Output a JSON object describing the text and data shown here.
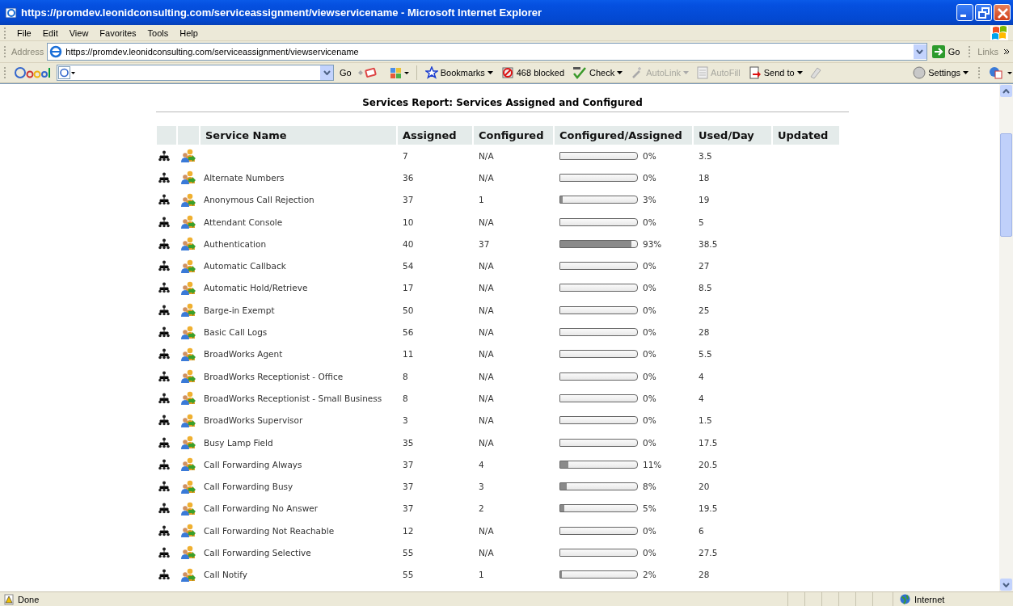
{
  "window": {
    "title": "https://promdev.leonidconsulting.com/serviceassignment/viewservicename - Microsoft Internet Explorer"
  },
  "menu": [
    "File",
    "Edit",
    "View",
    "Favorites",
    "Tools",
    "Help"
  ],
  "address_bar": {
    "label": "Address",
    "value": "https://promdev.leonidconsulting.com/serviceassignment/viewservicename",
    "go": "Go",
    "links": "Links"
  },
  "google_toolbar": {
    "go": "Go",
    "items": [
      {
        "kind": "star",
        "label": "Bookmarks",
        "disabled": false,
        "dropdown": true
      },
      {
        "kind": "blocked",
        "label": "468 blocked",
        "disabled": false,
        "dropdown": false
      },
      {
        "kind": "check",
        "label": "Check",
        "disabled": false,
        "dropdown": true
      },
      {
        "kind": "wand",
        "label": "AutoLink",
        "disabled": true,
        "dropdown": true
      },
      {
        "kind": "form",
        "label": "AutoFill",
        "disabled": true,
        "dropdown": false
      },
      {
        "kind": "send",
        "label": "Send to",
        "disabled": false,
        "dropdown": true
      }
    ],
    "settings": "Settings"
  },
  "report": {
    "title": "Services Report: Services Assigned and Configured",
    "columns": [
      "Service Name",
      "Assigned",
      "Configured",
      "Configured/Assigned",
      "Used/Day",
      "Updated"
    ],
    "rows": [
      {
        "assigned": "7",
        "configured": "N/A",
        "level": 0,
        "percent": "0%",
        "used_per_day": "3.5"
      },
      {
        "name": "Alternate Numbers",
        "assigned": "36",
        "configured": "N/A",
        "level": 0,
        "percent": "0%",
        "used_per_day": "18"
      },
      {
        "name": "Anonymous Call Rejection",
        "assigned": "37",
        "configured": "1",
        "level": 0.03,
        "percent": "3%",
        "used_per_day": "19"
      },
      {
        "name": "Attendant Console",
        "assigned": "10",
        "configured": "N/A",
        "level": 0,
        "percent": "0%",
        "used_per_day": "5"
      },
      {
        "name": "Authentication",
        "assigned": "40",
        "configured": "37",
        "level": 0.93,
        "percent": "93%",
        "used_per_day": "38.5"
      },
      {
        "name": "Automatic Callback",
        "assigned": "54",
        "configured": "N/A",
        "level": 0,
        "percent": "0%",
        "used_per_day": "27"
      },
      {
        "name": "Automatic Hold/Retrieve",
        "assigned": "17",
        "configured": "N/A",
        "level": 0,
        "percent": "0%",
        "used_per_day": "8.5"
      },
      {
        "name": "Barge-in Exempt",
        "assigned": "50",
        "configured": "N/A",
        "level": 0,
        "percent": "0%",
        "used_per_day": "25"
      },
      {
        "name": "Basic Call Logs",
        "assigned": "56",
        "configured": "N/A",
        "level": 0,
        "percent": "0%",
        "used_per_day": "28"
      },
      {
        "name": "BroadWorks Agent",
        "assigned": "11",
        "configured": "N/A",
        "level": 0,
        "percent": "0%",
        "used_per_day": "5.5"
      },
      {
        "name": "BroadWorks Receptionist - Office",
        "assigned": "8",
        "configured": "N/A",
        "level": 0,
        "percent": "0%",
        "used_per_day": "4"
      },
      {
        "name": "BroadWorks Receptionist - Small Business",
        "assigned": "8",
        "configured": "N/A",
        "level": 0,
        "percent": "0%",
        "used_per_day": "4"
      },
      {
        "name": "BroadWorks Supervisor",
        "assigned": "3",
        "configured": "N/A",
        "level": 0,
        "percent": "0%",
        "used_per_day": "1.5"
      },
      {
        "name": "Busy Lamp Field",
        "assigned": "35",
        "configured": "N/A",
        "level": 0,
        "percent": "0%",
        "used_per_day": "17.5"
      },
      {
        "name": "Call Forwarding Always",
        "assigned": "37",
        "configured": "4",
        "level": 0.11,
        "percent": "11%",
        "used_per_day": "20.5"
      },
      {
        "name": "Call Forwarding Busy",
        "assigned": "37",
        "configured": "3",
        "level": 0.08,
        "percent": "8%",
        "used_per_day": "20"
      },
      {
        "name": "Call Forwarding No Answer",
        "assigned": "37",
        "configured": "2",
        "level": 0.05,
        "percent": "5%",
        "used_per_day": "19.5"
      },
      {
        "name": "Call Forwarding Not Reachable",
        "assigned": "12",
        "configured": "N/A",
        "level": 0,
        "percent": "0%",
        "used_per_day": "6"
      },
      {
        "name": "Call Forwarding Selective",
        "assigned": "55",
        "configured": "N/A",
        "level": 0,
        "percent": "0%",
        "used_per_day": "27.5"
      },
      {
        "name": "Call Notify",
        "assigned": "55",
        "configured": "1",
        "level": 0.02,
        "percent": "2%",
        "used_per_day": "28"
      }
    ]
  },
  "status_bar": {
    "text": "Done",
    "zone": "Internet"
  }
}
